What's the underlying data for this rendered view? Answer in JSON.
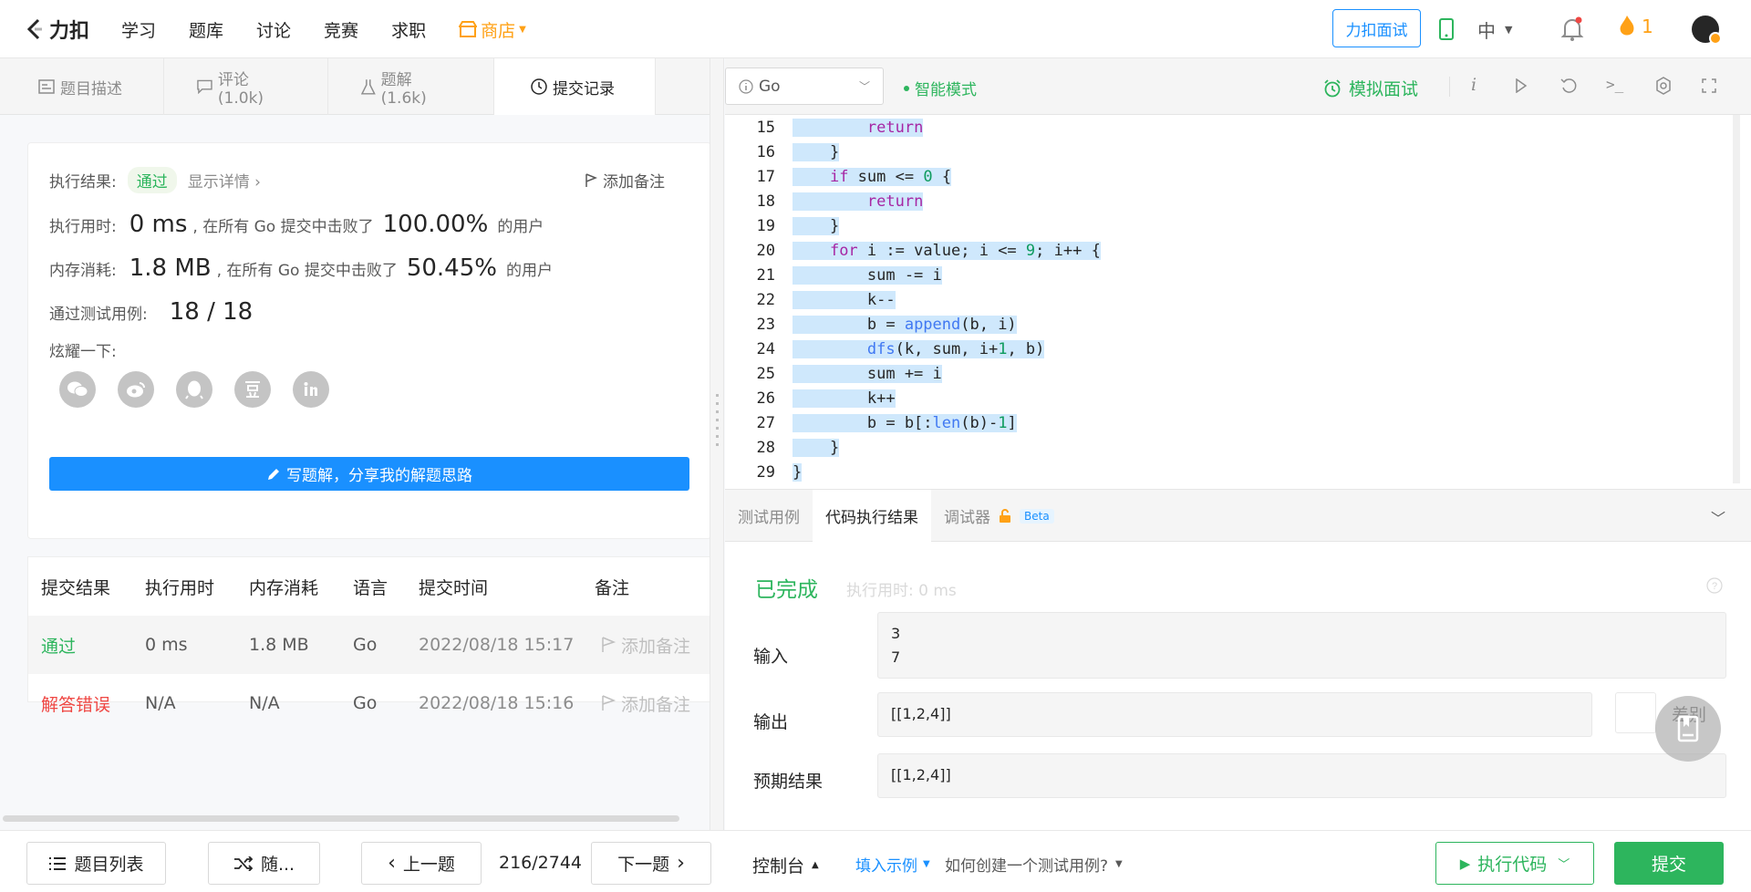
{
  "nav": {
    "logo_text": "力扣",
    "items": [
      "学习",
      "题库",
      "讨论",
      "竞赛",
      "求职"
    ],
    "shop": "商店",
    "interview_btn": "力扣面试",
    "lang": "中",
    "streak": "1"
  },
  "left_tabs": [
    {
      "label": "题目描述"
    },
    {
      "label": "评论 (1.0k)"
    },
    {
      "label": "题解 (1.6k)"
    },
    {
      "label": "提交记录"
    }
  ],
  "result": {
    "status_label": "执行结果:",
    "status": "通过",
    "show_details": "显示详情 ›",
    "add_note": "添加备注",
    "time_label": "执行用时:",
    "time_value": "0 ms",
    "time_desc": ", 在所有 Go 提交中击败了",
    "time_pct": "100.00%",
    "users": "的用户",
    "mem_label": "内存消耗:",
    "mem_value": "1.8 MB",
    "mem_desc": ", 在所有 Go 提交中击败了",
    "mem_pct": "50.45%",
    "cases_label": "通过测试用例:",
    "cases_value": "18 / 18",
    "share_label": "炫耀一下:",
    "write_btn": "写题解，分享我的解题思路"
  },
  "table": {
    "headers": [
      "提交结果",
      "执行用时",
      "内存消耗",
      "语言",
      "提交时间",
      "备注"
    ],
    "rows": [
      {
        "result": "通过",
        "time": "0 ms",
        "memory": "1.8 MB",
        "lang": "Go",
        "submitted": "2022/08/18 15:17",
        "note": "添加备注"
      },
      {
        "result": "解答错误",
        "time": "N/A",
        "memory": "N/A",
        "lang": "Go",
        "submitted": "2022/08/18 15:16",
        "note": "添加备注"
      }
    ]
  },
  "editor": {
    "language": "Go",
    "smart_mode": "智能模式",
    "mock_interview": "模拟面试"
  },
  "code_lines": [
    {
      "n": "15",
      "text": "        return"
    },
    {
      "n": "16",
      "text": "    }"
    },
    {
      "n": "17",
      "text": "    if sum <= 0 {"
    },
    {
      "n": "18",
      "text": "        return"
    },
    {
      "n": "19",
      "text": "    }"
    },
    {
      "n": "20",
      "text": "    for i := value; i <= 9; i++ {"
    },
    {
      "n": "21",
      "text": "        sum -= i"
    },
    {
      "n": "22",
      "text": "        k--"
    },
    {
      "n": "23",
      "text": "        b = append(b, i)"
    },
    {
      "n": "24",
      "text": "        dfs(k, sum, i+1, b)"
    },
    {
      "n": "25",
      "text": "        sum += i"
    },
    {
      "n": "26",
      "text": "        k++"
    },
    {
      "n": "27",
      "text": "        b = b[:len(b)-1]"
    },
    {
      "n": "28",
      "text": "    }"
    },
    {
      "n": "29",
      "text": "}"
    }
  ],
  "run_panel": {
    "tabs": [
      "测试用例",
      "代码执行结果",
      "调试器"
    ],
    "beta": "Beta",
    "done": "已完成",
    "time_info": "执行用时: 0 ms",
    "input_label": "输入",
    "input_value": "3\n7",
    "output_label": "输出",
    "output_value": "[[1,2,4]]",
    "diff_label": "差别",
    "expected_label": "预期结果",
    "expected_value": "[[1,2,4]]"
  },
  "bottom": {
    "problem_list": "题目列表",
    "random": "随...",
    "prev": "上一题",
    "counter": "216/2744",
    "next": "下一题",
    "console": "控制台",
    "fill_example": "填入示例",
    "how_to": "如何创建一个测试用例?",
    "run_code": "执行代码",
    "submit": "提交"
  },
  "colors": {
    "green": "#2db55d",
    "blue": "#1a90ff",
    "orange": "#ffa116",
    "red": "#ef4743"
  }
}
